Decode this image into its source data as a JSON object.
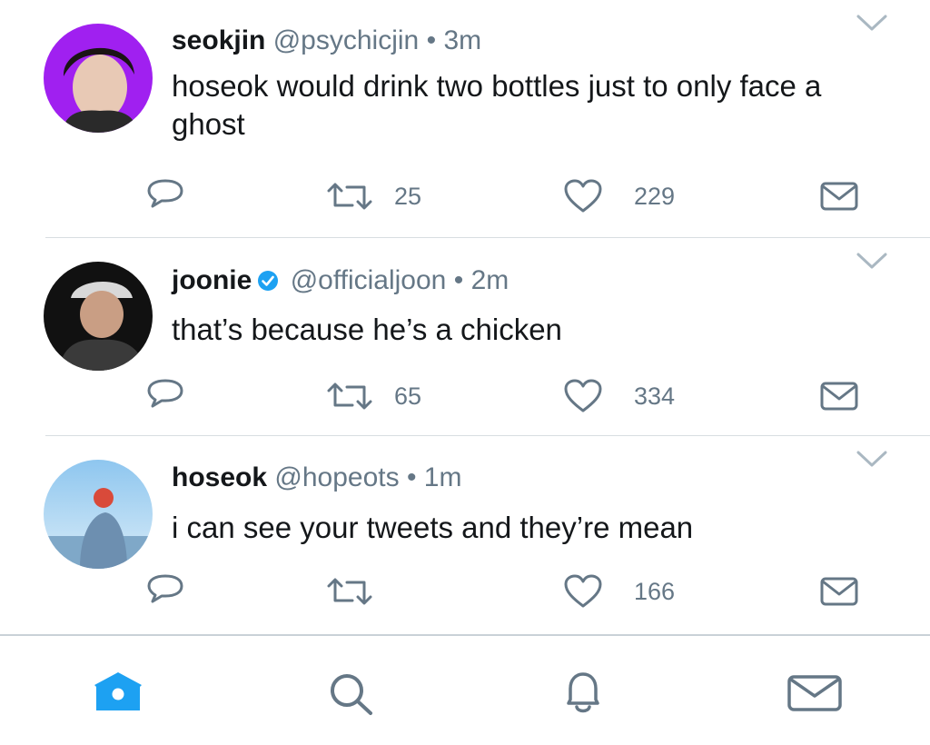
{
  "tweets": [
    {
      "name": "seokjin",
      "handle": "@psychicjin",
      "separator": "•",
      "time": "3m",
      "verified": false,
      "text": "hoseok would drink two bottles just to only face a ghost",
      "retweets": "25",
      "likes": "229"
    },
    {
      "name": "joonie",
      "handle": "@officialjoon",
      "separator": "•",
      "time": "2m",
      "verified": true,
      "text": "that’s because he’s a chicken",
      "retweets": "65",
      "likes": "334"
    },
    {
      "name": "hoseok",
      "handle": "@hopeots",
      "separator": "•",
      "time": "1m",
      "verified": false,
      "text": "i can see your tweets and they’re mean",
      "retweets": "",
      "likes": "166"
    }
  ],
  "colors": {
    "accent": "#1da1f2",
    "icon_gray": "#657786",
    "divider": "#d8dde1"
  },
  "icons": [
    "reply-icon",
    "retweet-icon",
    "like-icon",
    "direct-message-icon",
    "chevron-down-icon",
    "verified-badge-icon",
    "home-icon",
    "search-icon",
    "notifications-icon",
    "messages-icon"
  ],
  "nav": {
    "active": "home"
  }
}
